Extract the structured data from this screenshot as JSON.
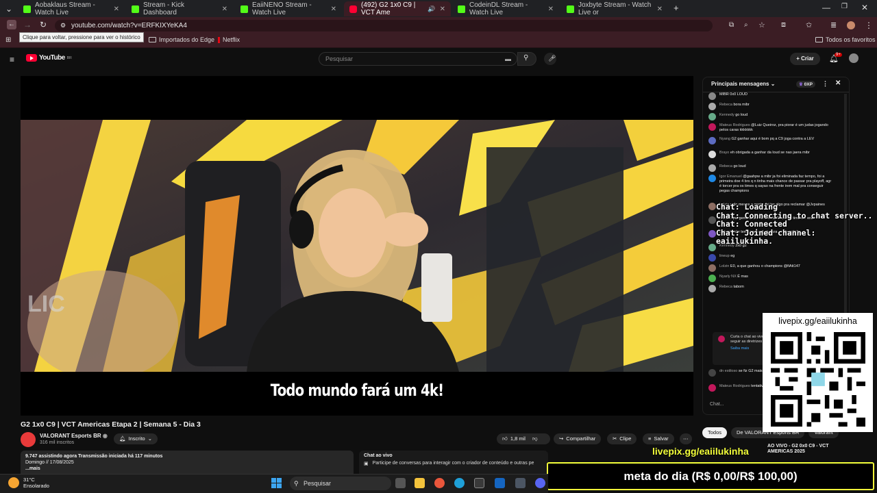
{
  "browser": {
    "tabs": [
      {
        "label": "Aobaklaus Stream - Watch Live",
        "kind": "kick"
      },
      {
        "label": "Stream - Kick Dashboard",
        "kind": "kick"
      },
      {
        "label": "EaiiNENO Stream - Watch Live",
        "kind": "kick"
      },
      {
        "label": "(492) G2 1x0 C9 | VCT Ame",
        "kind": "yt"
      },
      {
        "label": "CodeinDL Stream - Watch Live",
        "kind": "kick"
      },
      {
        "label": "Joxbyte Stream - Watch Live or",
        "kind": "kick"
      }
    ],
    "url": "youtube.com/watch?v=ERFKIXYeKA4",
    "tooltip": "Clique para voltar, pressione para ver o histórico",
    "bookmarks": [
      "Importados do Edge",
      "Netflix"
    ],
    "all_favorites": "Todos os favoritos"
  },
  "youtube": {
    "logo": "YouTube",
    "region": "BR",
    "search_placeholder": "Pesquisar",
    "create_label": "Criar",
    "notif_count": "9+"
  },
  "video": {
    "subtitle": "Todo mundo fará um 4k!",
    "title": "G2 1x0 C9 | VCT Americas Etapa 2 | Semana 5 - Dia 3",
    "channel": "VALORANT Esports BR",
    "subscribers": "316 mil inscritos",
    "subscribed_label": "Inscrito",
    "likes": "1,8 mil",
    "share_label": "Compartilhar",
    "clip_label": "Clipe",
    "save_label": "Salvar",
    "desc_line1": "9.747 assistindo agora  Transmissão iniciada há 117 minutos",
    "desc_line2": "Domingo // 17/08/2025",
    "desc_more": "...mais",
    "chat_live_title": "Chat ao vivo",
    "chat_live_text": "Participe de conversas para interagir com o criador de conteúdo e outras pe"
  },
  "chat": {
    "header": "Principais mensagens",
    "points": "0XP",
    "input_placeholder": "Chat...",
    "messages": [
      {
        "author": "",
        "text": "MIBR 0x0 LOUD",
        "color": "#888"
      },
      {
        "author": "Rebeca",
        "text": "bora mibr",
        "color": "#aaa"
      },
      {
        "author": "Kennedy",
        "text": "go loud",
        "color": "#6a8"
      },
      {
        "author": "Mateus Rodrigues",
        "text": "@Luiz Queiroz, pra piorar é um judas jogando pelos caras kkkkkkk",
        "color": "#c2185b"
      },
      {
        "author": "Nyang",
        "text": "G2 ganhar aqui é bom pq a C9 joga contra a LEV",
        "color": "#5c6bc0"
      },
      {
        "author": "Brayo",
        "text": "eh obrigada a ganhar da loud se nao jaera mibr",
        "color": "#ddd"
      },
      {
        "author": "Rebeca",
        "text": "go loud",
        "color": "#aaa"
      },
      {
        "author": "Igor Emanuel",
        "text": "@gaahpw a mibr ja foi eliminada faz tempo, foi a primeira doe 4 brs q n tinha mais chance de passar pra playoff, agr é torcer pra os times q sayao na frente irem mal pra conseguir pegas champions",
        "color": "#1e88e5"
      },
      {
        "author": "Lolzin",
        "text": "pelo menos a gente vai ter algo pra reclamar @Jvpaines",
        "color": "#8d6e63"
      },
      {
        "author": "fiAtt147",
        "text": "jawgemo antes de ser da G2 , de q time ele era?",
        "color": "#555"
      },
      {
        "author": "Delno7",
        "text": "mibr tem chance de ir para os playoffs?",
        "color": "#7e57c2"
      },
      {
        "author": "Kennedy",
        "text": "2x0 g2",
        "color": "#6a8"
      },
      {
        "author": "lineup",
        "text": "eg",
        "color": "#3949ab"
      },
      {
        "author": "Lolzin",
        "text": "E0, a que ganhou o champions @fiAtt147",
        "color": "#8d6e63"
      },
      {
        "author": "Nyarly NX",
        "text": "É mas",
        "color": "#4caf50"
      },
      {
        "author": "Rebeca",
        "text": "tabom",
        "color": "#aaa"
      }
    ],
    "notice": "Curta o chat ao vivo! Lembre-se de proteger sua privacidade e seguir as diretrizes da comunidade",
    "notice_link": "Saiba mais",
    "after_messages": [
      {
        "author": "dn estiloso",
        "text": "se fiz G2 mais ig qual o criterio de",
        "color": "#444"
      },
      {
        "author": "Mateus Rodrigues",
        "text": "tentativa do que de",
        "color": "#c2185b"
      }
    ]
  },
  "overlay": {
    "lines": [
      "Chat: Loading",
      "Chat: Connecting to chat server..",
      "Chat: Connected",
      "Chat: Joined channel: eaiilukinha."
    ],
    "qr_url": "livepix.gg/eaiilukinha",
    "livepix_banner": "livepix.gg/eaiilukinha",
    "meta": "meta do dia (R$ 0,00/R$ 100,00)",
    "next_video_title": "AO VIVO - G2 0x0 C9 - VCT AMERICAS 2025",
    "chips": [
      "Todos",
      "De VALORANT Esports BR",
      "Valorant"
    ]
  },
  "taskbar": {
    "temp": "31°C",
    "weather": "Ensolarado",
    "search": "Pesquisar"
  }
}
